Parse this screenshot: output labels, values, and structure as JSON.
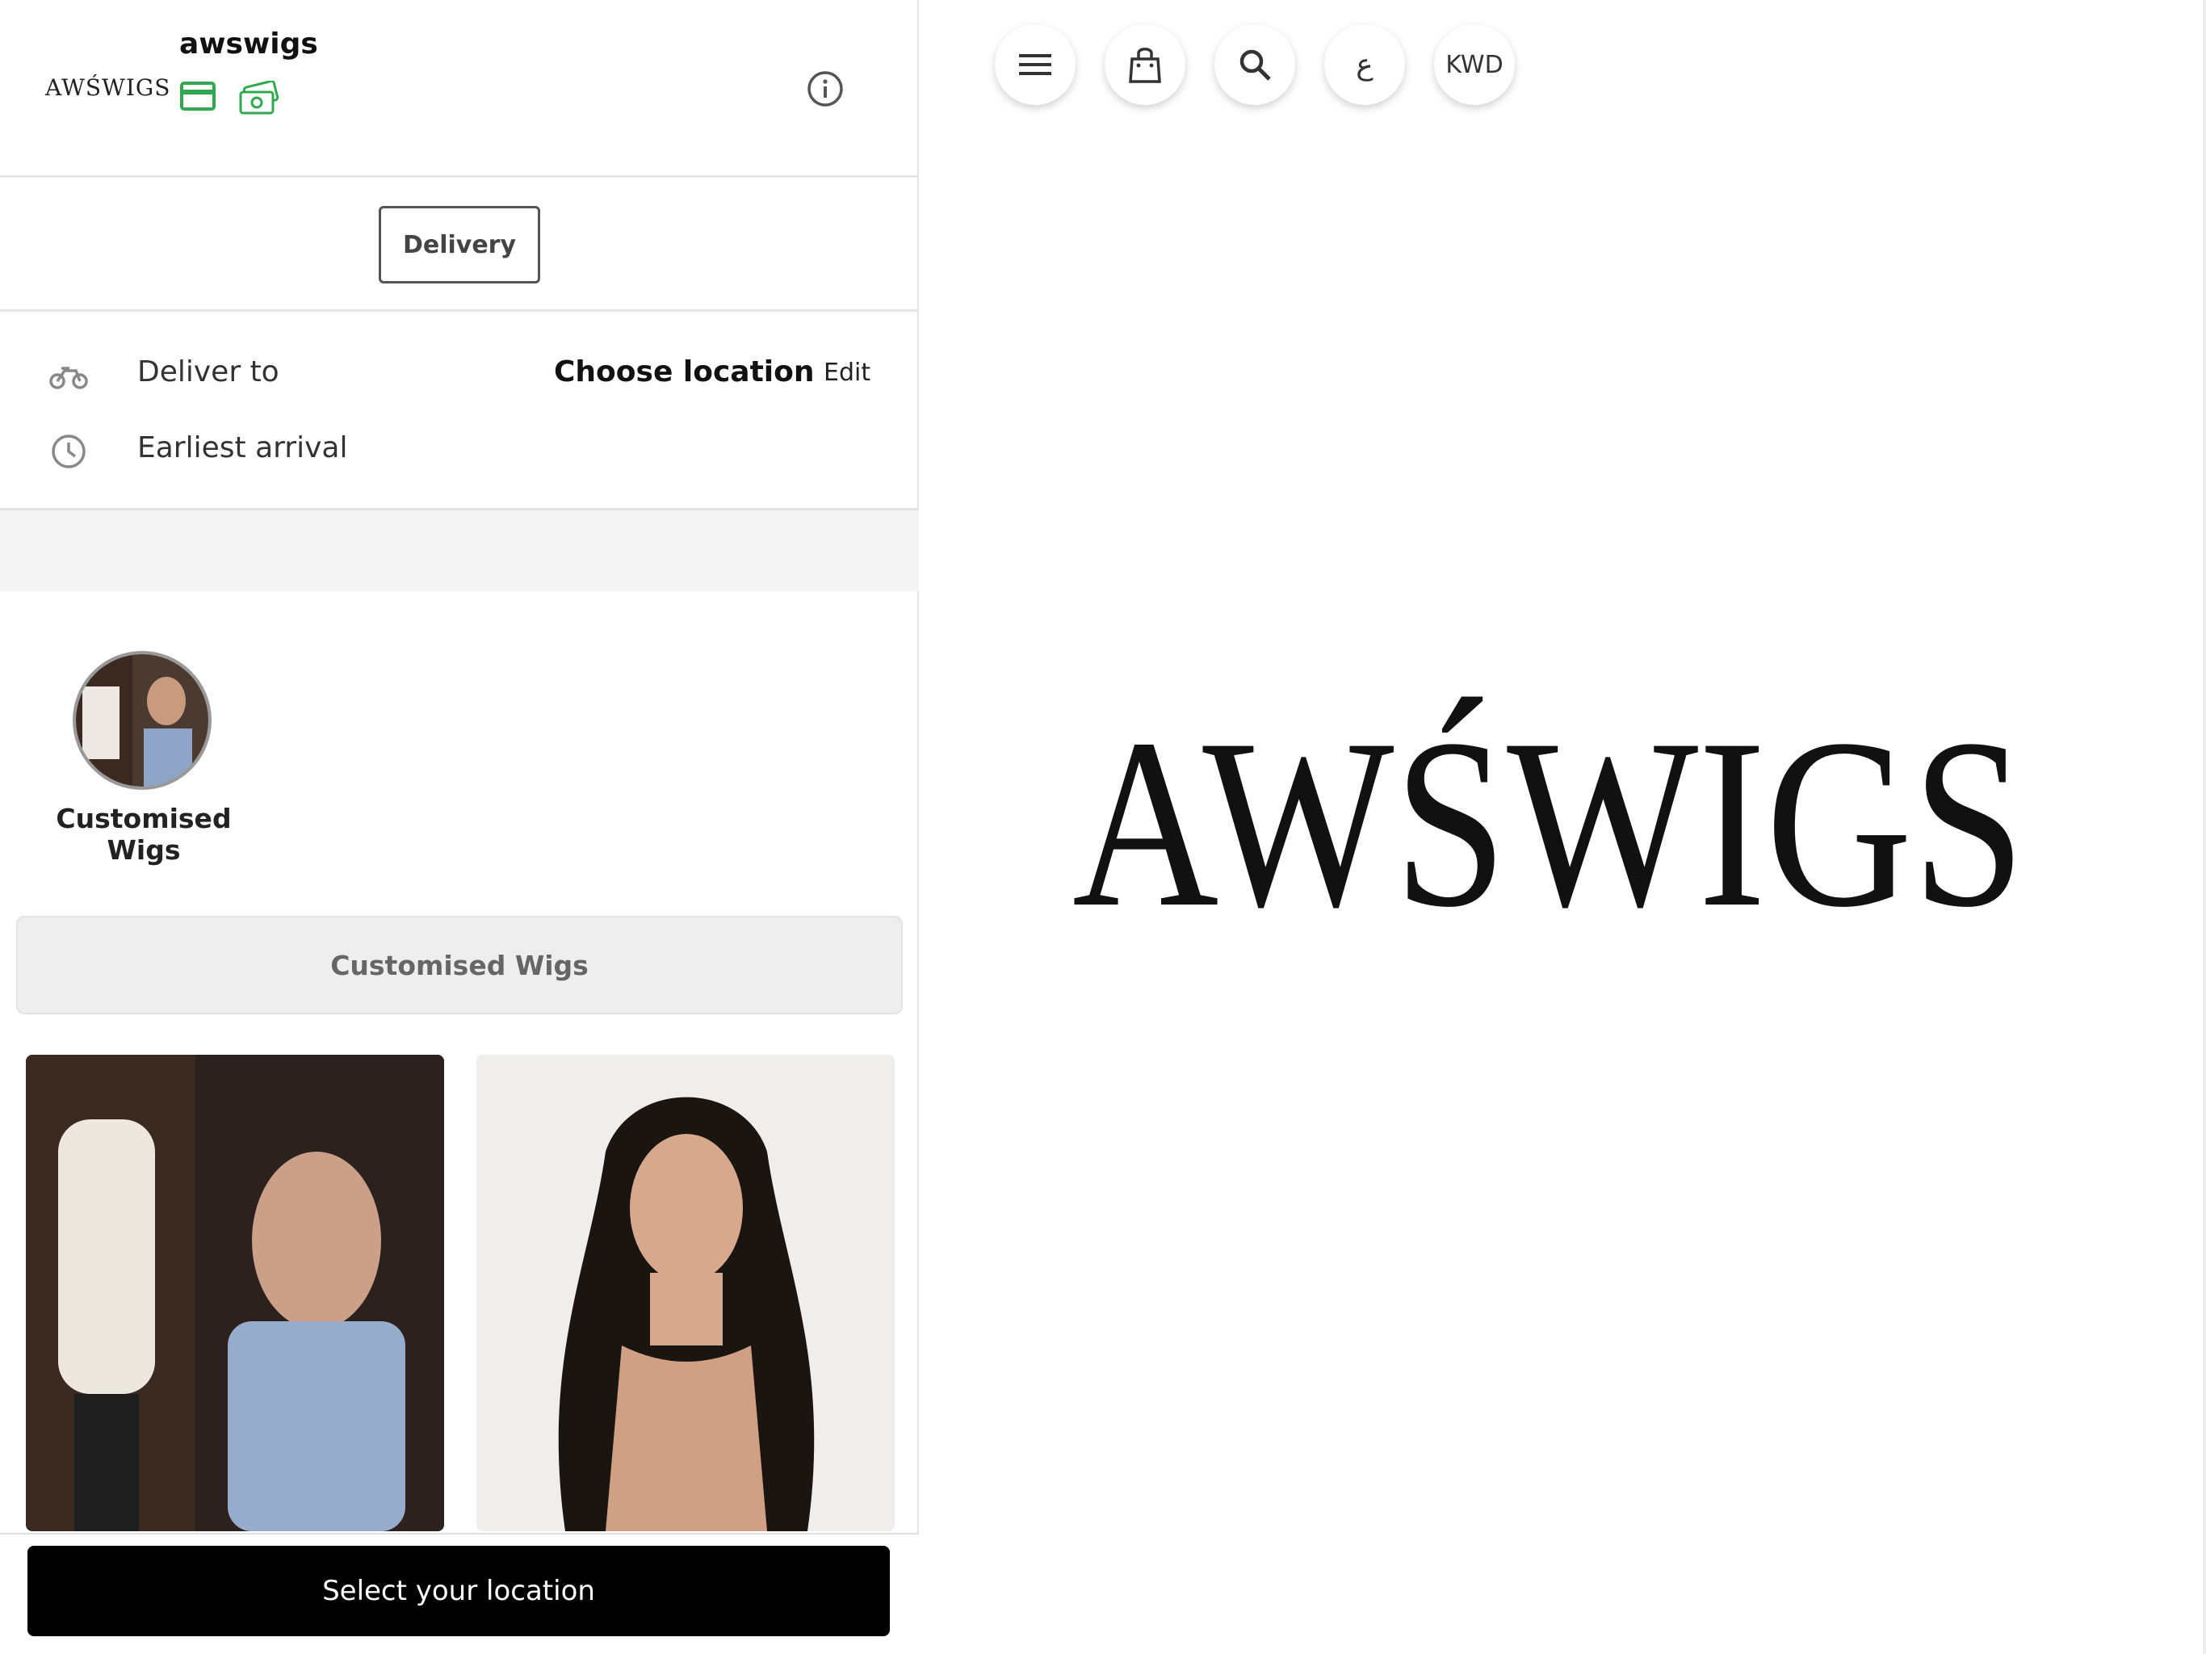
{
  "header": {
    "brand_mini": "AWŚWIGS",
    "store_name": "awswigs",
    "payment_icons": [
      "credit-card-icon",
      "cash-icon"
    ],
    "info_icon": "info-icon"
  },
  "order_mode": {
    "selected_label": "Delivery"
  },
  "delivery": {
    "deliver_to_label": "Deliver to",
    "deliver_to_value": "Choose location",
    "edit_label": "Edit",
    "earliest_arrival_label": "Earliest arrival"
  },
  "categories": [
    {
      "label": "Customised Wigs"
    }
  ],
  "section_title": "Customised Wigs",
  "bottom_action": {
    "label": "Select your location"
  },
  "top_nav": {
    "lang_label": "ع",
    "currency_label": "KWD"
  },
  "big_logo": {
    "text": "AWŚWIGS"
  },
  "colors": {
    "accent_green": "#2fa84f",
    "primary_button": "#000000"
  }
}
